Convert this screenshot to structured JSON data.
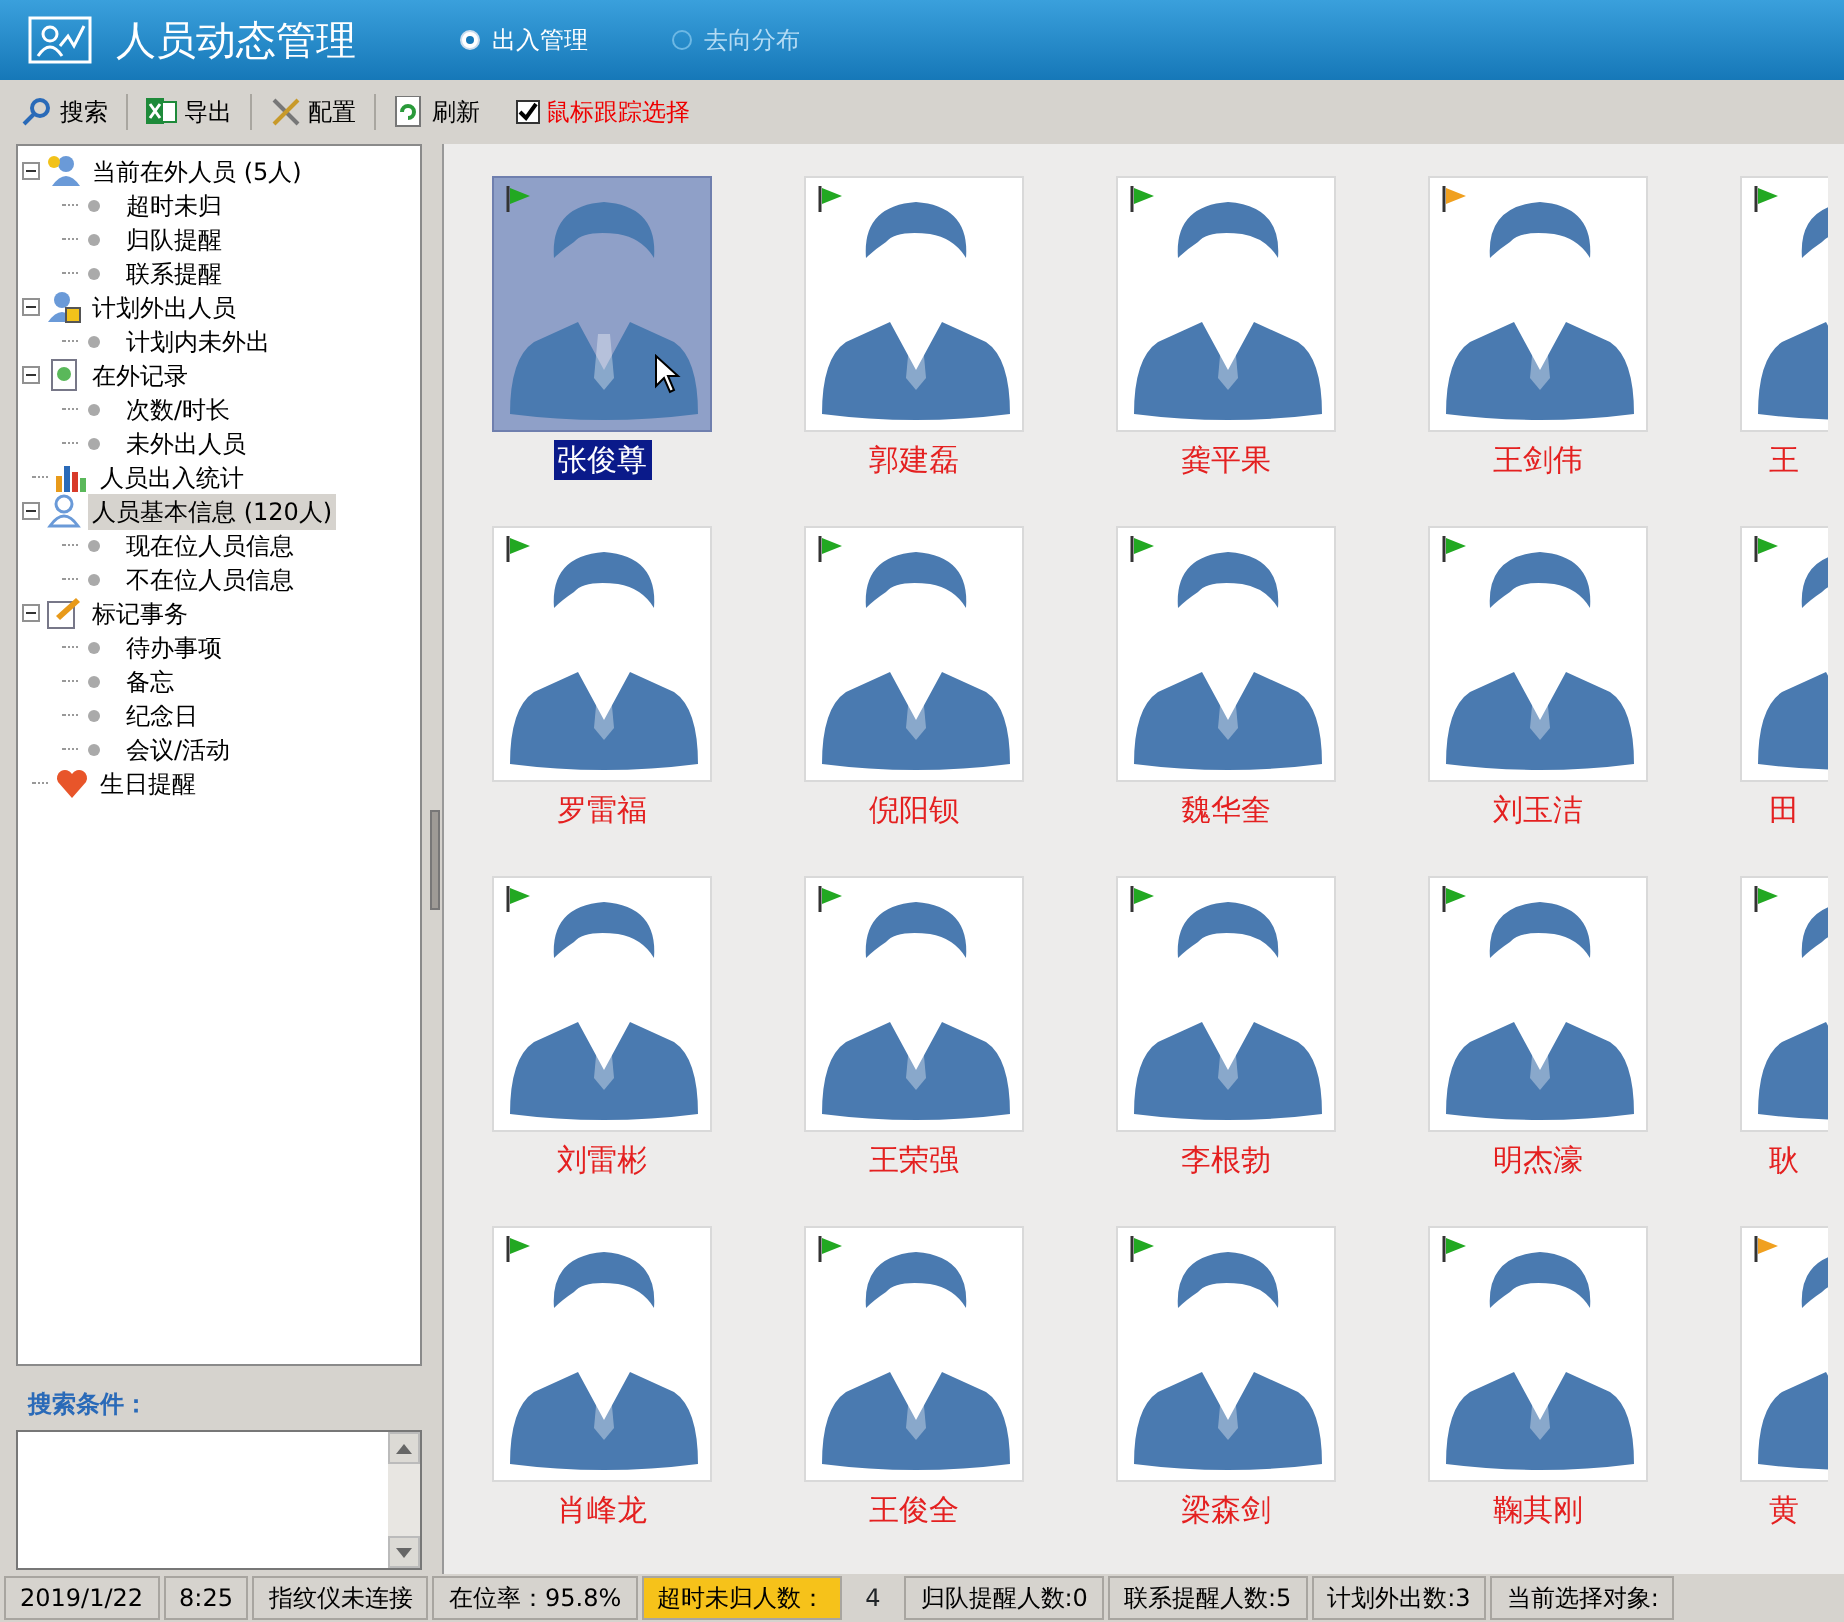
{
  "window": {
    "title": "人员动态管理"
  },
  "modes": [
    {
      "label": "出入管理",
      "selected": true,
      "disabled": false
    },
    {
      "label": "去向分布",
      "selected": false,
      "disabled": true
    }
  ],
  "toolbar": {
    "buttons": [
      {
        "label": "搜索",
        "kind": "search"
      },
      {
        "label": "导出",
        "kind": "excel"
      },
      {
        "label": "配置",
        "kind": "tools"
      },
      {
        "label": "刷新",
        "kind": "refresh"
      }
    ],
    "tracking": {
      "label": "鼠标跟踪选择",
      "checked": true
    }
  },
  "tree": [
    {
      "label": "当前在外人员",
      "count": "(5人)",
      "kind": "people-out",
      "expanded": true,
      "selected": false,
      "children": [
        {
          "label": "超时未归"
        },
        {
          "label": "归队提醒"
        },
        {
          "label": "联系提醒"
        }
      ]
    },
    {
      "label": "计划外出人员",
      "kind": "people-plan",
      "expanded": true,
      "selected": false,
      "children": [
        {
          "label": "计划内未外出"
        }
      ]
    },
    {
      "label": "在外记录",
      "kind": "record",
      "expanded": true,
      "selected": false,
      "children": [
        {
          "label": "次数/时长"
        },
        {
          "label": "未外出人员"
        }
      ]
    },
    {
      "label": "人员出入统计",
      "kind": "chart",
      "selected": false
    },
    {
      "label": "人员基本信息",
      "count": "(120人)",
      "kind": "person",
      "expanded": true,
      "selected": true,
      "children": [
        {
          "label": "现在位人员信息"
        },
        {
          "label": "不在位人员信息"
        }
      ]
    },
    {
      "label": "标记事务",
      "kind": "note",
      "expanded": true,
      "selected": false,
      "children": [
        {
          "label": "待办事项"
        },
        {
          "label": "备忘"
        },
        {
          "label": "纪念日"
        },
        {
          "label": "会议/活动"
        }
      ]
    },
    {
      "label": "生日提醒",
      "kind": "heart",
      "selected": false
    }
  ],
  "search": {
    "label": "搜索条件："
  },
  "people": [
    {
      "name": "张俊尊",
      "color": "#22a822",
      "selected": true,
      "kind": "full"
    },
    {
      "name": "郭建磊",
      "color": "#22a822",
      "selected": false,
      "kind": "full"
    },
    {
      "name": "龚平果",
      "color": "#22a822",
      "selected": false,
      "kind": "full"
    },
    {
      "name": "王剑伟",
      "color": "#f0a020",
      "selected": false,
      "kind": "full"
    },
    {
      "name": "王",
      "color": "#22a822",
      "selected": false,
      "kind": "cut"
    },
    {
      "name": "罗雷福",
      "color": "#22a822",
      "selected": false,
      "kind": "full"
    },
    {
      "name": "倪阳钡",
      "color": "#22a822",
      "selected": false,
      "kind": "full"
    },
    {
      "name": "魏华奎",
      "color": "#22a822",
      "selected": false,
      "kind": "full"
    },
    {
      "name": "刘玉洁",
      "color": "#22a822",
      "selected": false,
      "kind": "full"
    },
    {
      "name": "田",
      "color": "#22a822",
      "selected": false,
      "kind": "cut"
    },
    {
      "name": "刘雷彬",
      "color": "#22a822",
      "selected": false,
      "kind": "full"
    },
    {
      "name": "王荣强",
      "color": "#22a822",
      "selected": false,
      "kind": "full"
    },
    {
      "name": "李根勃",
      "color": "#22a822",
      "selected": false,
      "kind": "full"
    },
    {
      "name": "明杰濠",
      "color": "#22a822",
      "selected": false,
      "kind": "full"
    },
    {
      "name": "耿",
      "color": "#22a822",
      "selected": false,
      "kind": "cut"
    },
    {
      "name": "肖峰龙",
      "color": "#22a822",
      "selected": false,
      "kind": "full"
    },
    {
      "name": "王俊全",
      "color": "#22a822",
      "selected": false,
      "kind": "full"
    },
    {
      "name": "梁森剑",
      "color": "#22a822",
      "selected": false,
      "kind": "full"
    },
    {
      "name": "鞠其刚",
      "color": "#22a822",
      "selected": false,
      "kind": "full"
    },
    {
      "name": "黄",
      "color": "#f0a020",
      "selected": false,
      "kind": "cut"
    }
  ],
  "status_bar": [
    {
      "text": "2019/1/22",
      "highlighted": false
    },
    {
      "text": "8:25",
      "highlighted": false
    },
    {
      "text": "指纹仪未连接",
      "highlighted": false
    },
    {
      "text": "在位率：95.8%",
      "highlighted": false
    },
    {
      "text": "超时未归人数：",
      "value": "4",
      "highlighted": true
    },
    {
      "text": "归队提醒人数:0",
      "highlighted": false
    },
    {
      "text": "联系提醒人数:5",
      "highlighted": false
    },
    {
      "text": "计划外出数:3",
      "highlighted": false
    },
    {
      "text": "当前选择对象:",
      "highlighted": false
    }
  ]
}
